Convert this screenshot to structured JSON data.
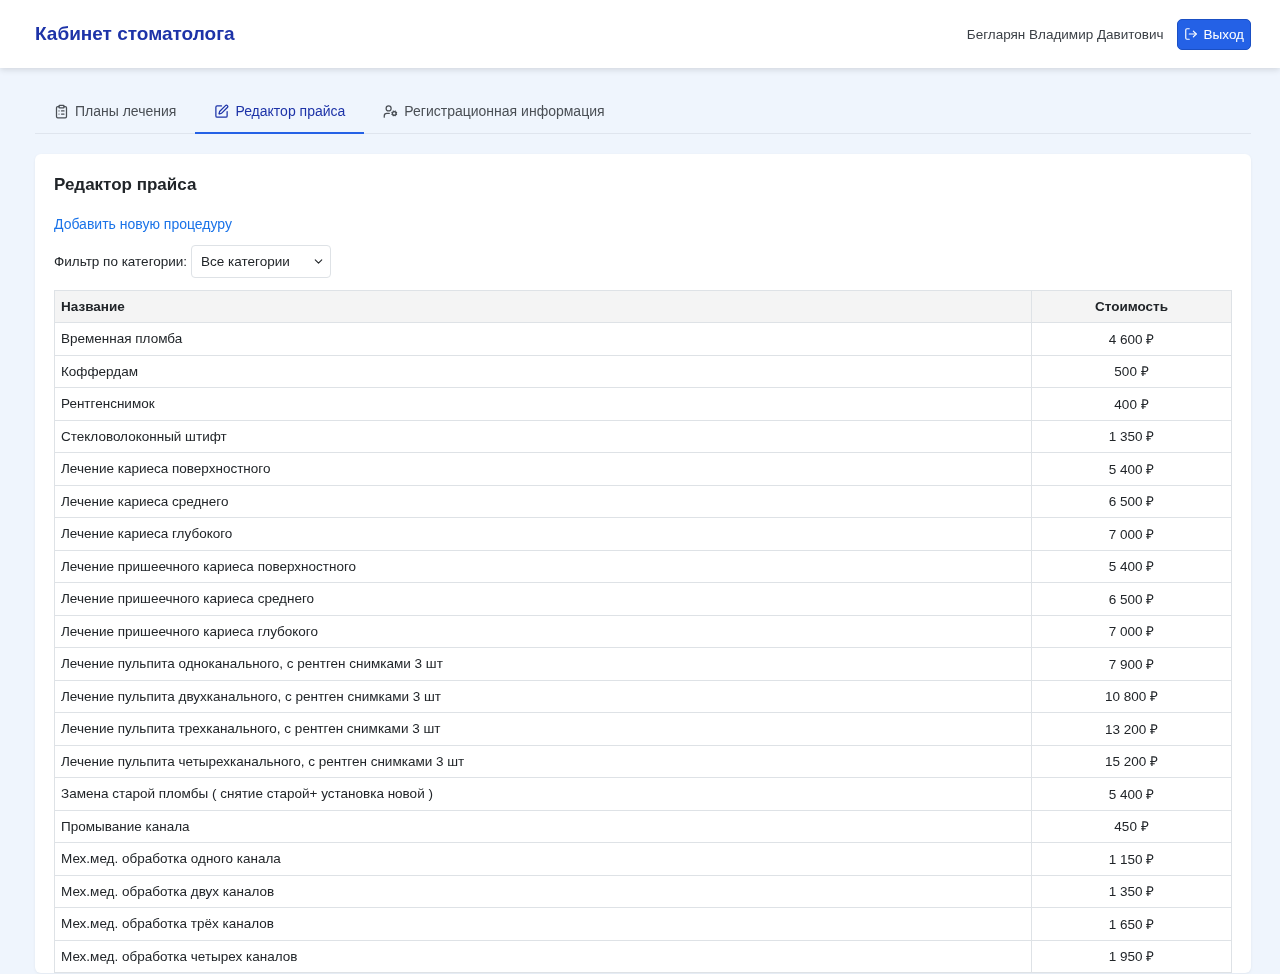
{
  "header": {
    "title": "Кабинет стоматолога",
    "user": "Бегларян Владимир Давитович",
    "logout_button": "Выход"
  },
  "tabs": [
    {
      "label": "Планы лечения",
      "selected": false
    },
    {
      "label": "Редактор прайса",
      "selected": true
    },
    {
      "label": "Регистрационная информация",
      "selected": false
    }
  ],
  "card": {
    "title": "Редактор прайса",
    "add_link": "Добавить новую процедуру",
    "filter_label": "Фильтр по категории:",
    "filter_value": "Все категории"
  },
  "table": {
    "columns": [
      "Название",
      "Стоимость"
    ],
    "rows": [
      [
        "Временная пломба",
        "4 600 ₽"
      ],
      [
        "Коффердам",
        "500 ₽"
      ],
      [
        "Рентгенснимок",
        "400 ₽"
      ],
      [
        "Стекловолоконный штифт",
        "1 350 ₽"
      ],
      [
        "Лечение кариеса поверхностного",
        "5 400 ₽"
      ],
      [
        "Лечение кариеса среднего",
        "6 500 ₽"
      ],
      [
        "Лечение кариеса глубокого",
        "7 000 ₽"
      ],
      [
        "Лечение пришеечного кариеса поверхностного",
        "5 400 ₽"
      ],
      [
        "Лечение пришеечного кариеса среднего",
        "6 500 ₽"
      ],
      [
        "Лечение пришеечного кариеса глубокого",
        "7 000 ₽"
      ],
      [
        "Лечение пульпита одноканального, с рентген снимками 3 шт",
        "7 900 ₽"
      ],
      [
        "Лечение пульпита двухканального, с рентген снимками 3 шт",
        "10 800 ₽"
      ],
      [
        "Лечение пульпита трехканального, с рентген снимками 3 шт",
        "13 200 ₽"
      ],
      [
        "Лечение пульпита четырехканального, с рентген снимками 3 шт",
        "15 200 ₽"
      ],
      [
        "Замена старой пломбы ( снятие старой+ установка новой )",
        "5 400 ₽"
      ],
      [
        "Промывание канала",
        "450 ₽"
      ],
      [
        "Мех.мед. обработка одного канала",
        "1 150 ₽"
      ],
      [
        "Мех.мед. обработка двух каналов",
        "1 350 ₽"
      ],
      [
        "Мех.мед. обработка трёх каналов",
        "1 650 ₽"
      ],
      [
        "Мех.мед. обработка четырех каналов",
        "1 950 ₽"
      ]
    ]
  }
}
